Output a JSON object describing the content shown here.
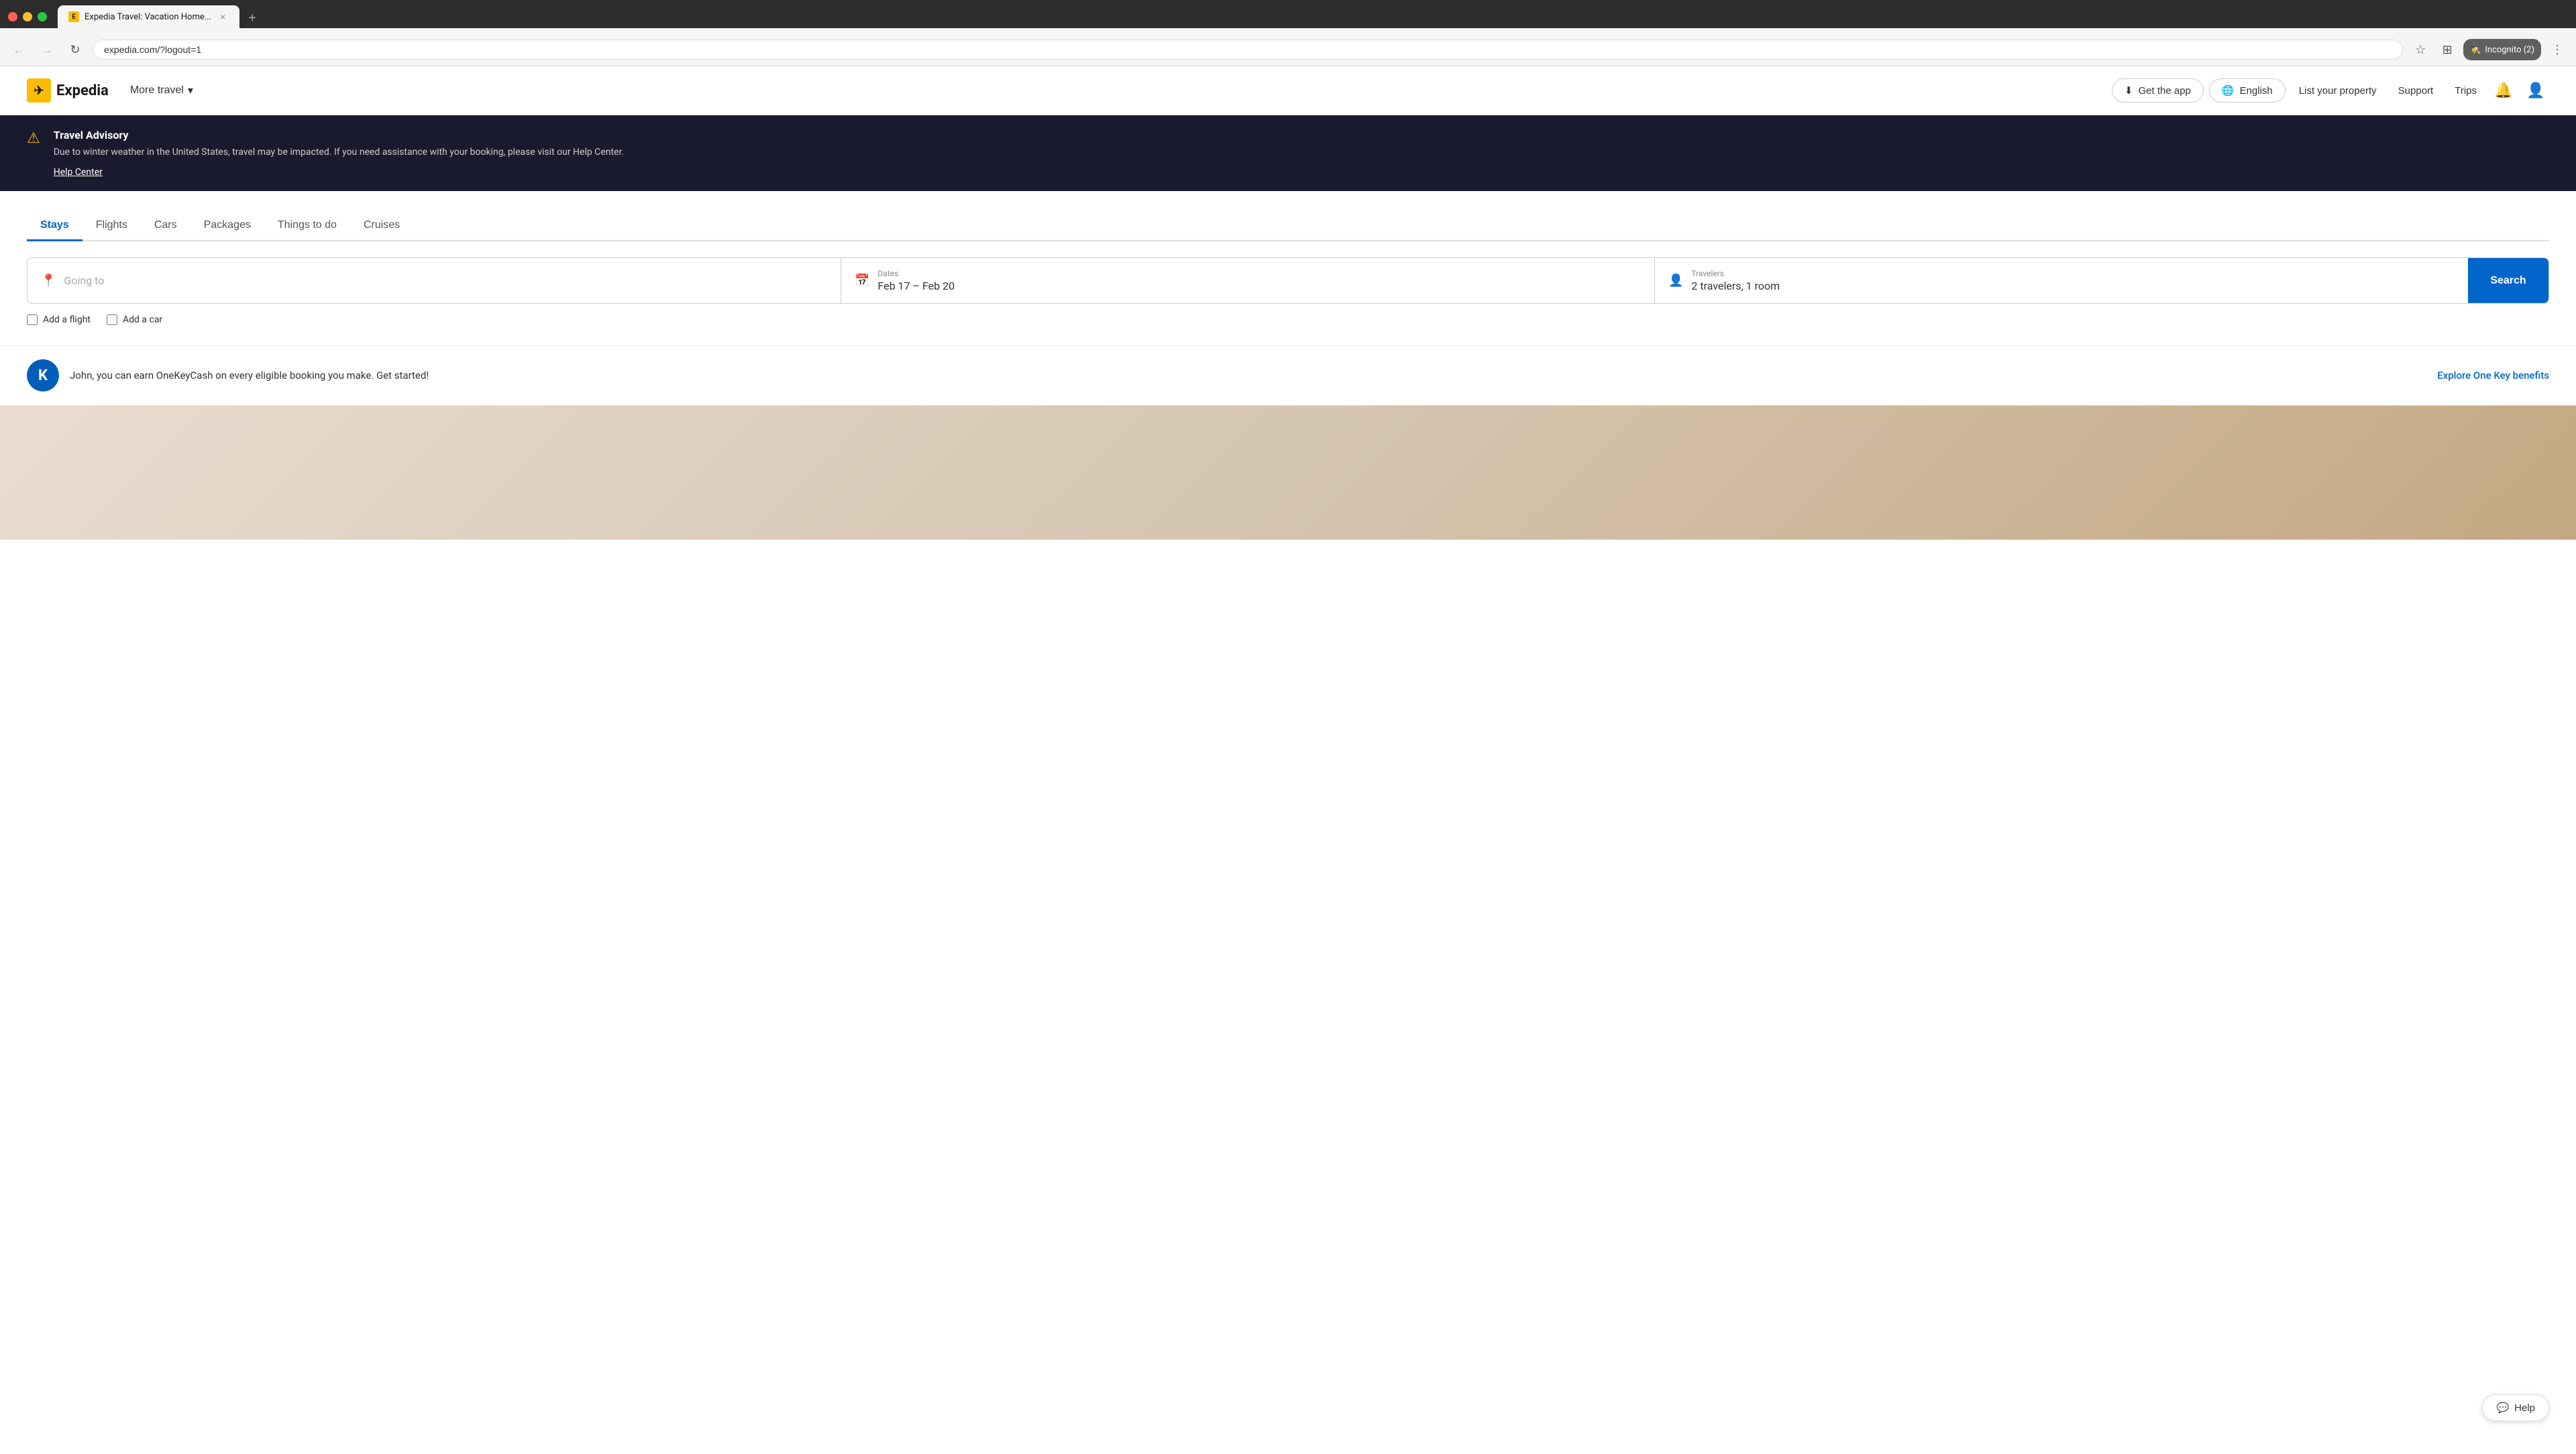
{
  "browser": {
    "tab_title": "Expedia Travel: Vacation Home...",
    "tab_favicon_text": "E",
    "new_tab_label": "+",
    "address": "expedia.com/?logout=1",
    "incognito_label": "Incognito (2)"
  },
  "site_header": {
    "logo_text": "Expedia",
    "logo_icon_text": "✈",
    "more_travel_label": "More travel",
    "get_app_label": "Get the app",
    "english_label": "English",
    "list_property_label": "List your property",
    "support_label": "Support",
    "trips_label": "Trips"
  },
  "advisory": {
    "title": "Travel Advisory",
    "body": "Due to winter weather in the United States, travel may be impacted. If you need assistance with your booking, please visit our Help Center.",
    "link_label": "Help Center"
  },
  "search": {
    "tabs": [
      {
        "label": "Stays",
        "active": true
      },
      {
        "label": "Flights",
        "active": false
      },
      {
        "label": "Cars",
        "active": false
      },
      {
        "label": "Packages",
        "active": false
      },
      {
        "label": "Things to do",
        "active": false
      },
      {
        "label": "Cruises",
        "active": false
      }
    ],
    "going_to_placeholder": "Going to",
    "going_to_icon": "📍",
    "dates_label": "Dates",
    "dates_value": "Feb 17 – Feb 20",
    "dates_icon": "📅",
    "travelers_label": "Travelers",
    "travelers_value": "2 travelers, 1 room",
    "travelers_icon": "👤",
    "search_button_label": "Search",
    "add_flight_label": "Add a flight",
    "add_car_label": "Add a car"
  },
  "onekey": {
    "avatar_letter": "K",
    "message": "John, you can earn OneKeyCash on every eligible booking you make. Get started!",
    "explore_label": "Explore One Key benefits"
  },
  "help": {
    "label": "Help",
    "icon": "💬"
  }
}
